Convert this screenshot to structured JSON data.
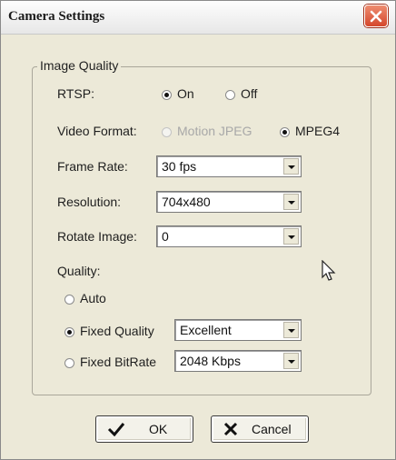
{
  "window": {
    "title": "Camera Settings"
  },
  "group": {
    "title": "Image Quality",
    "rtsp": {
      "label": "RTSP:",
      "options": [
        "On",
        "Off"
      ],
      "selected": "On"
    },
    "video_format": {
      "label": "Video Format:",
      "options": [
        "Motion JPEG",
        "MPEG4"
      ],
      "selected": "MPEG4",
      "disabled_option": "Motion JPEG"
    },
    "frame_rate": {
      "label": "Frame Rate:",
      "value": "30 fps"
    },
    "resolution": {
      "label": "Resolution:",
      "value": "704x480"
    },
    "rotate_image": {
      "label": "Rotate Image:",
      "value": "0"
    },
    "quality": {
      "label": "Quality:",
      "auto_label": "Auto",
      "fixed_quality_label": "Fixed Quality",
      "fixed_quality_value": "Excellent",
      "fixed_bitrate_label": "Fixed BitRate",
      "fixed_bitrate_value": "2048 Kbps",
      "selected": "Fixed Quality"
    }
  },
  "buttons": {
    "ok": "OK",
    "cancel": "Cancel"
  },
  "icons": {
    "close": "close-icon",
    "ok": "checkmark-icon",
    "cancel": "x-mark-icon",
    "cursor": "mouse-pointer-icon"
  },
  "colors": {
    "close_button": "#d4462b",
    "dialog_bg": "#ece9d8"
  }
}
